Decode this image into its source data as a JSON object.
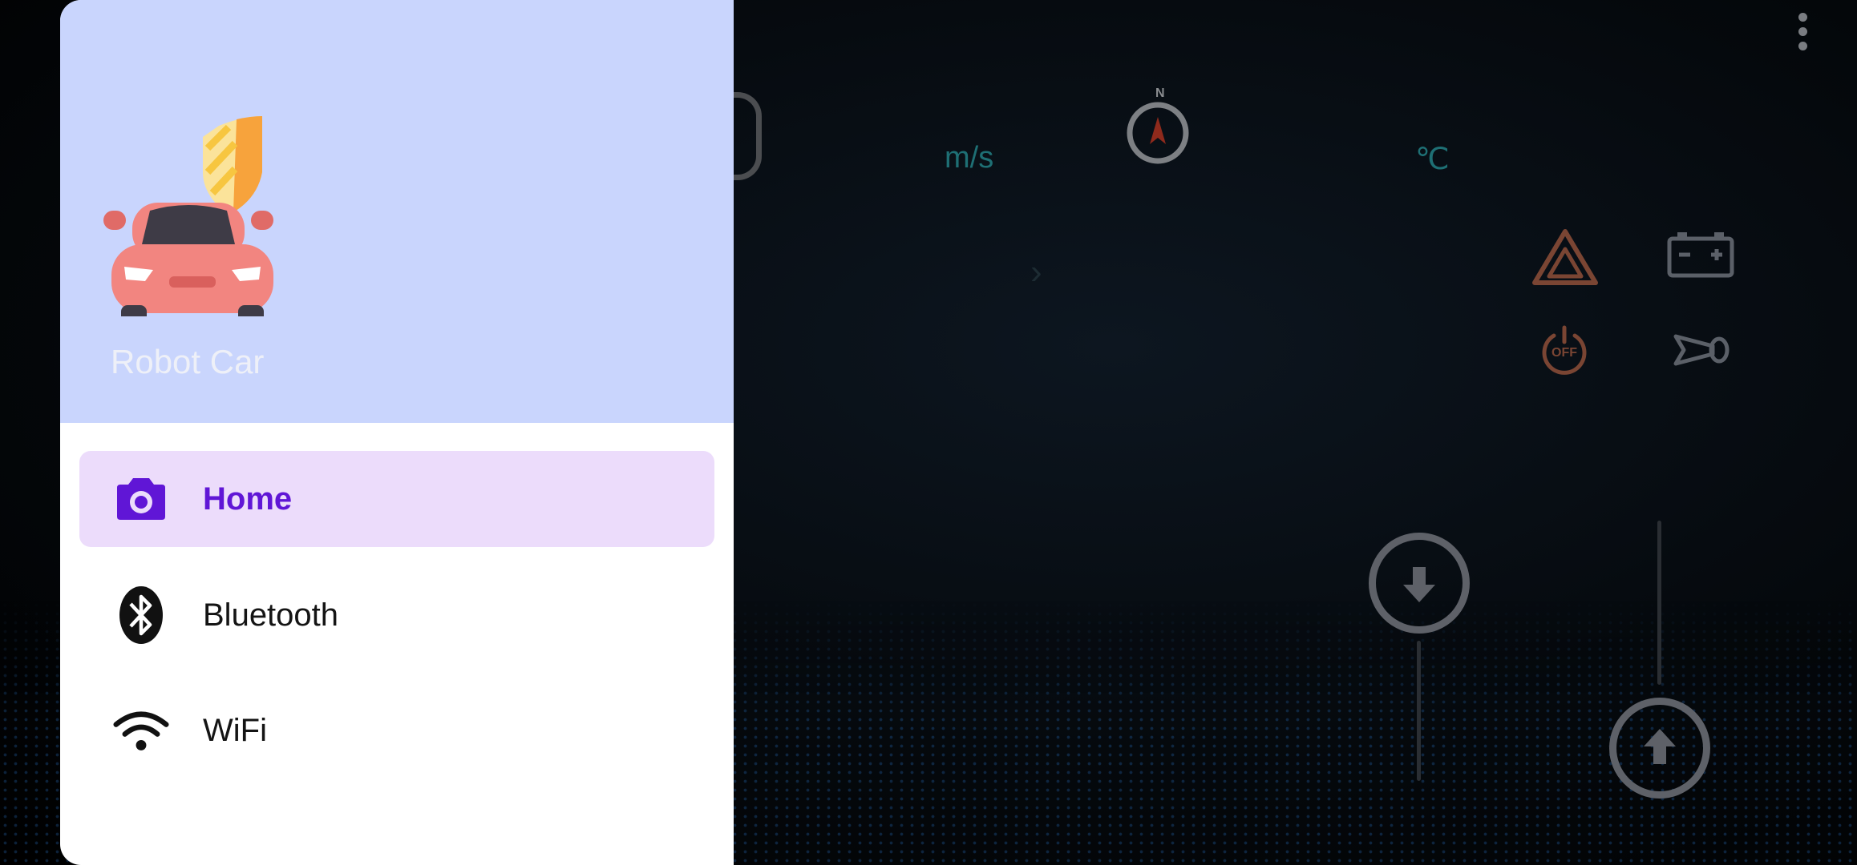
{
  "drawer": {
    "app_name": "Robot Car",
    "items": [
      {
        "label": "Home",
        "icon": "camera-icon",
        "active": true
      },
      {
        "label": "Bluetooth",
        "icon": "bluetooth-icon",
        "active": false
      },
      {
        "label": "WiFi",
        "icon": "wifi-icon",
        "active": false
      }
    ]
  },
  "dashboard": {
    "speed_unit": "m/s",
    "temp_unit": "℃",
    "compass_label": "N",
    "power_label": "OFF"
  },
  "colors": {
    "header_bg": "#c9d5fd",
    "active_item_bg": "#ecdcfb",
    "active_item_text": "#6016d6",
    "unit_text": "#1e6f74",
    "warning_icon": "#8a4a32"
  }
}
